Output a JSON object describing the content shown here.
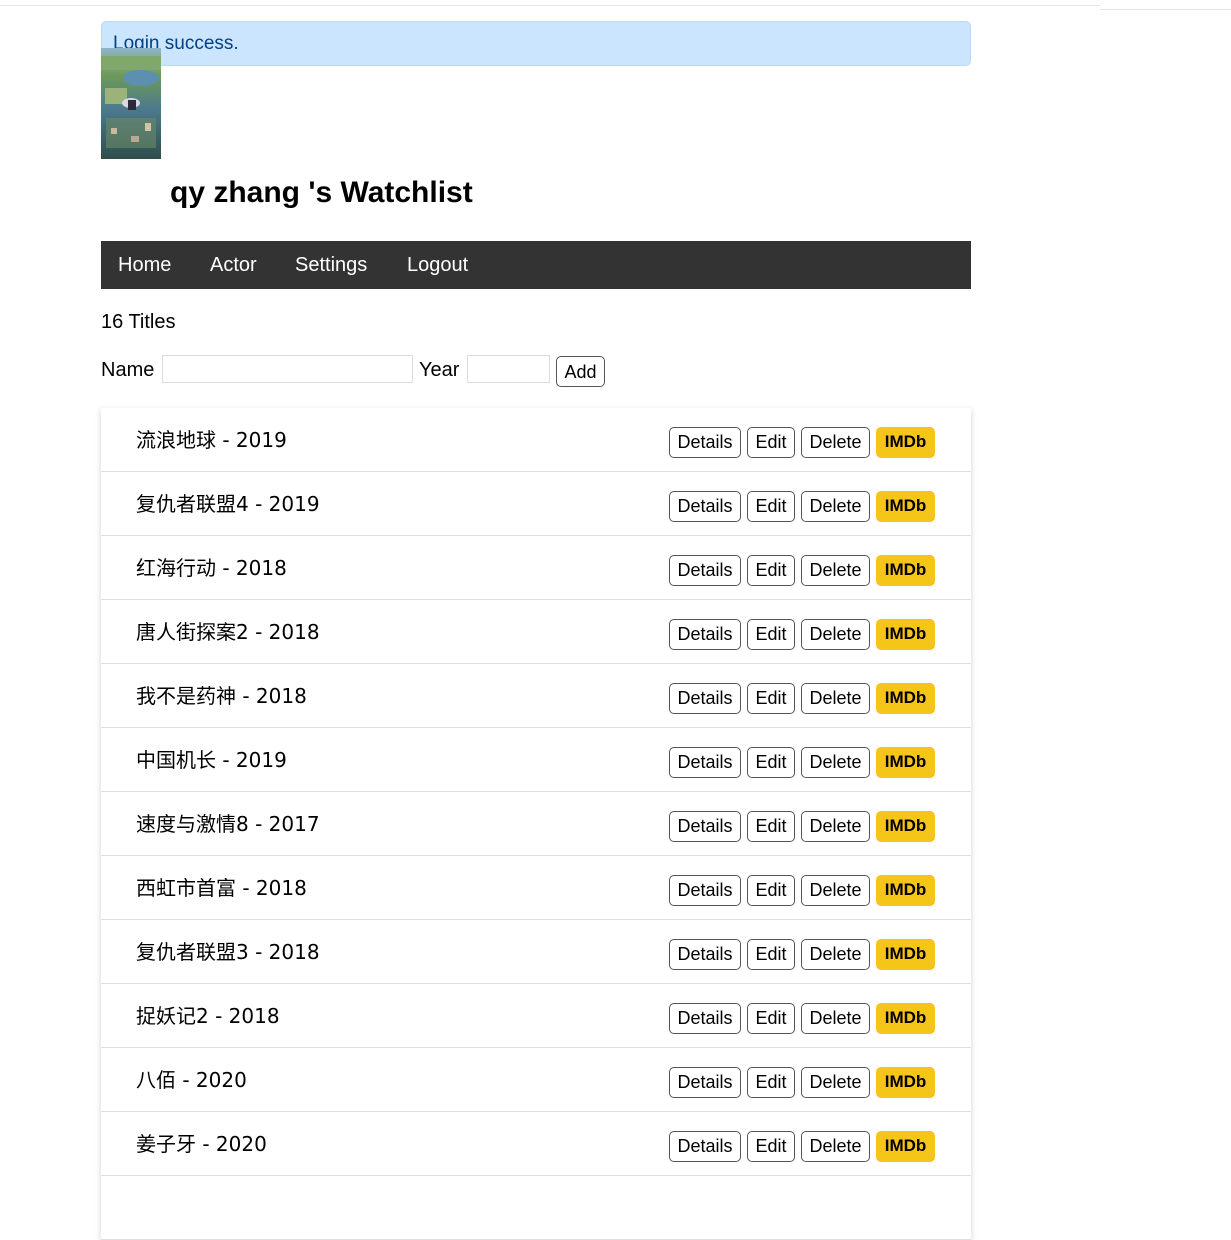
{
  "alert": {
    "text": "Login success."
  },
  "header": {
    "title": "qy zhang 's Watchlist",
    "avatar_icon": "avatar-image"
  },
  "nav": {
    "items": [
      "Home",
      "Actor",
      "Settings",
      "Logout"
    ]
  },
  "count_text": "16 Titles",
  "form": {
    "name_label": "Name",
    "name_value": "",
    "year_label": "Year",
    "year_value": "",
    "add_label": "Add"
  },
  "buttons": {
    "details": "Details",
    "edit": "Edit",
    "delete": "Delete",
    "imdb": "IMDb"
  },
  "colors": {
    "alert_bg": "#cce5ff",
    "alert_text": "#004085",
    "nav_bg": "#333333",
    "imdb": "#f5c518"
  },
  "movies": [
    {
      "title": "流浪地球 - 2019"
    },
    {
      "title": "复仇者联盟4 - 2019"
    },
    {
      "title": "红海行动 - 2018"
    },
    {
      "title": "唐人街探案2 - 2018"
    },
    {
      "title": "我不是药神 - 2018"
    },
    {
      "title": "中国机长 - 2019"
    },
    {
      "title": "速度与激情8 - 2017"
    },
    {
      "title": "西虹市首富 - 2018"
    },
    {
      "title": "复仇者联盟3 - 2018"
    },
    {
      "title": "捉妖记2 - 2018"
    },
    {
      "title": "八佰 - 2020"
    },
    {
      "title": "姜子牙 - 2020"
    },
    {
      "title": ""
    }
  ]
}
